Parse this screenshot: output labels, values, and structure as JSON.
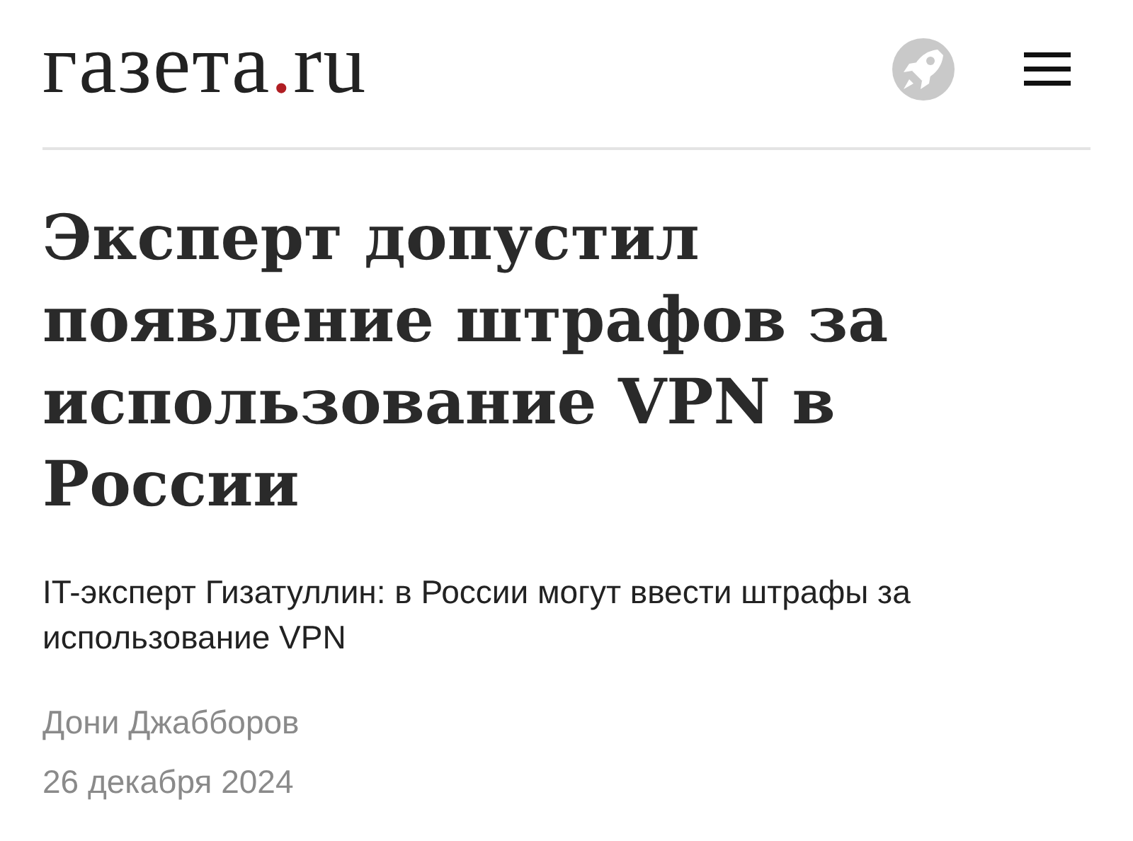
{
  "header": {
    "logo": {
      "name": "газета",
      "dot": ".",
      "domain": "ru"
    }
  },
  "article": {
    "title": "Эксперт допустил появление штрафов за использование VPN в России",
    "lead": "IT-эксперт Гизатуллин: в России могут ввести штрафы за использование VPN",
    "author": "Дони Джабборов",
    "date": "26 декабря 2024"
  }
}
